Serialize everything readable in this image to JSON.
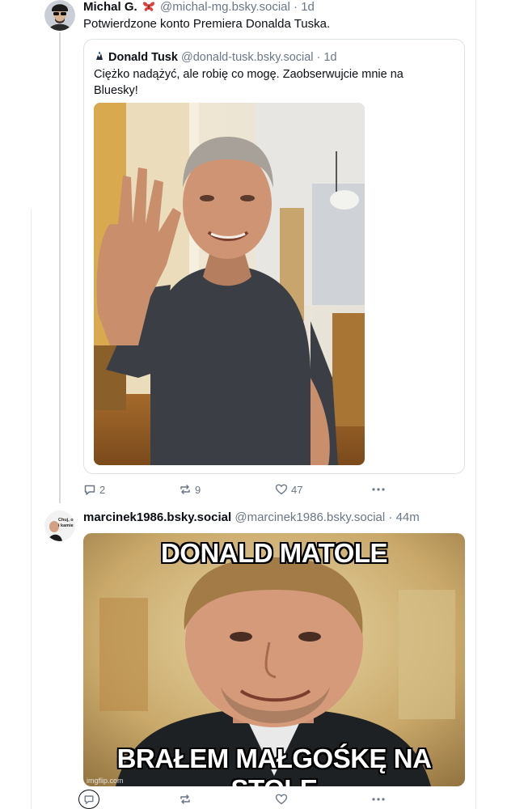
{
  "post1": {
    "display_name": "Michal G.",
    "name_emoji": "butterfly-emoji",
    "handle": "@michal-mg.bsky.social",
    "separator": " · ",
    "time": "1d",
    "text": "Potwierdzone konto Premiera Donalda Tuska.",
    "quote": {
      "display_name": "Donald Tusk",
      "handle": "@donald-tusk.bsky.social",
      "separator": " · ",
      "time": "1d",
      "text": "Ciężko nadążyć, ale robię co mogę. Zaobserwujcie mnie na Bluesky!"
    },
    "actions": {
      "replies": "2",
      "reposts": "9",
      "likes": "47"
    }
  },
  "post2": {
    "display_name": "marcinek1986.bsky.social",
    "handle": "@marcinek1986.bsky.social",
    "separator": " · ",
    "time": "44m",
    "avatar_text": "Chuj, o\ni kamie",
    "meme": {
      "top_text": "DONALD MATOLE",
      "bottom_text": "BRAŁEM MAŁGOŚKĘ NA STOLE",
      "watermark": "imgflip.com"
    }
  },
  "colors": {
    "text": "#0b0f14",
    "muted": "#6b7785",
    "border": "#dde2e8",
    "thread_line": "#d4d9e0"
  },
  "icons": [
    "reply-icon",
    "repost-icon",
    "like-icon",
    "more-icon",
    "butterfly-icon"
  ]
}
